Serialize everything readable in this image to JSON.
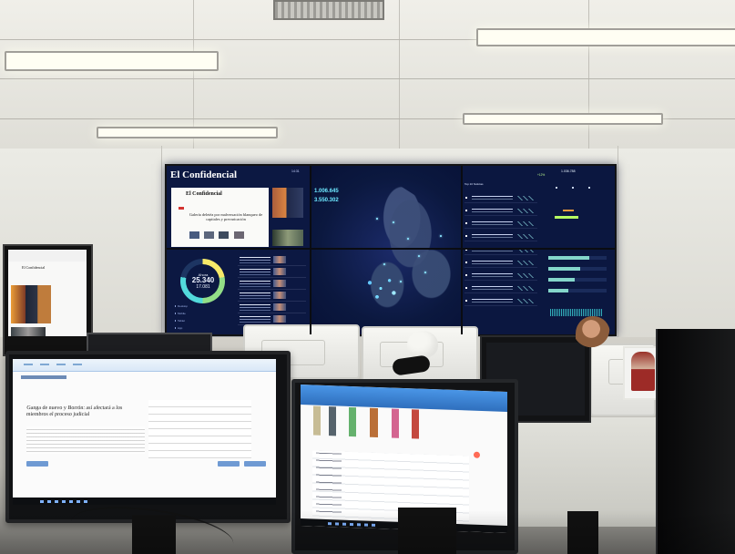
{
  "scene": {
    "setting": "newsroom control room",
    "palette": {
      "ceiling": "#e8e7e0",
      "wall": "#e3e2dc",
      "dashboard": "#0b1740",
      "accent_cyan": "#6de8ff",
      "accent_green": "#92de87",
      "accent_yellow": "#f7ea69"
    }
  },
  "video_wall": {
    "left_panel": {
      "brand": "El Confidencial",
      "top_right_label": "14:31",
      "site": {
        "logo": "El Confidencial",
        "headline": "Galería deletéa por malversación blanqueo de capitales y prevaricación"
      },
      "donut": {
        "now_label": "Ahora",
        "value": "25.340",
        "sub_value": "17.081",
        "legend": [
          "Desktop",
          "Mobile",
          "Tablet",
          "App"
        ]
      }
    },
    "map_panel": {
      "stat_1": "1.006.645",
      "stat_2": "3.550.302"
    },
    "analytics_panel": {
      "title": "Top 10 Noticias",
      "top_metric": "1.036.788",
      "small_metric": "+12%"
    }
  },
  "monitors": {
    "left_monitor": {
      "headline": "Ganga de nuevo y Borrón: así afectará a los miembros el proceso judicial"
    },
    "side_monitor": {
      "logo": "El Confidencial"
    }
  }
}
